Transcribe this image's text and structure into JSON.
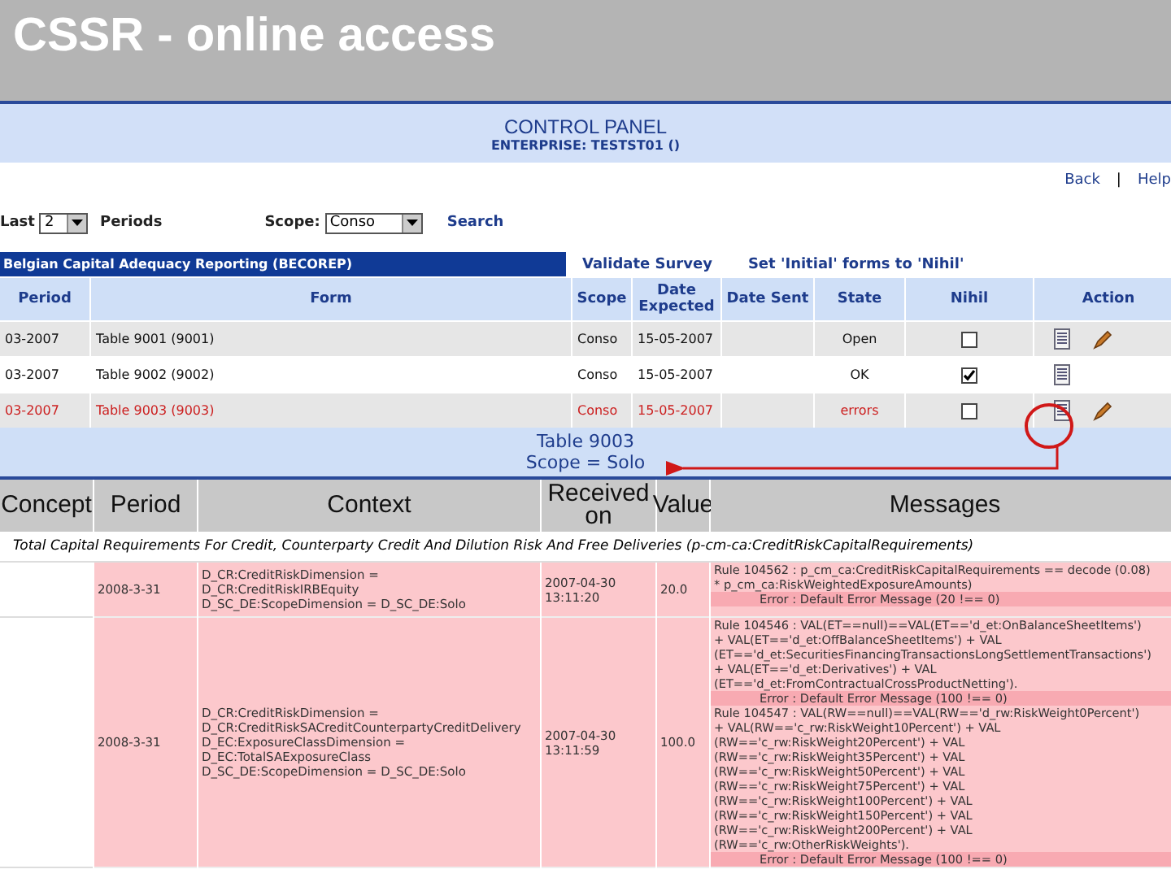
{
  "slide_title": "CSSR - online access",
  "control_panel": {
    "title": "CONTROL PANEL",
    "subtitle": "ENTERPRISE: TESTST01 ()"
  },
  "nav_links": [
    {
      "label": "Back"
    },
    {
      "label": "|",
      "kind": "separator"
    },
    {
      "label": "Help"
    }
  ],
  "filters": {
    "last_label": "Last",
    "periods_value": "2",
    "periods_label": "Periods",
    "scope_label": "Scope:",
    "scope_value": "Conso",
    "search_link": "Search"
  },
  "report": {
    "title": "Belgian Capital Adequacy Reporting  (BECOREP)",
    "links": [
      "Validate Survey",
      "Set 'Initial' forms to 'Nihil'"
    ]
  },
  "forms_table": {
    "columns": [
      "Period",
      "Form",
      "Scope",
      "Date Expected",
      "Date Sent",
      "State",
      "Nihil",
      "Action"
    ],
    "rows": [
      {
        "period": "03-2007",
        "form": "Table 9001  (9001)",
        "scope": "Conso",
        "date_expected": "15-05-2007",
        "state": "Open",
        "kind": "normal",
        "nihil": false,
        "edit_icon": true,
        "highlighted": false
      },
      {
        "period": "03-2007",
        "form": "Table 9002  (9002)",
        "scope": "Conso",
        "date_expected": "15-05-2007",
        "state": "OK",
        "kind": "normal",
        "nihil": true,
        "edit_icon": false,
        "highlighted": false
      },
      {
        "period": "03-2007",
        "form": "Table 9003  (9003)",
        "scope": "Conso",
        "date_expected": "15-05-2007",
        "state": "errors",
        "kind": "error",
        "nihil": false,
        "edit_icon": true,
        "highlighted": true
      }
    ]
  },
  "detail_panel": {
    "title": "Table 9003",
    "subtitle": "Scope = Solo"
  },
  "errors_table": {
    "columns": [
      "Concept",
      "Period",
      "Context",
      "Received on",
      "Value",
      "Messages"
    ],
    "concept_title": "Total Capital Requirements For Credit, Counterparty Credit And Dilution Risk And Free Deliveries  (p-cm-ca:CreditRiskCapitalRequirements)",
    "rows": [
      {
        "period": "2008-3-31",
        "context": [
          "D_CR:CreditRiskDimension = D_CR:CreditRiskIRBEquity",
          "D_SC_DE:ScopeDimension = D_SC_DE:Solo"
        ],
        "received_on": "2007-04-30 13:11:20",
        "value": "20.0",
        "messages": [
          {
            "kind": "rule",
            "lines": [
              "Rule 104562 : p_cm_ca:CreditRiskCapitalRequirements == decode (0.08)",
              "* p_cm_ca:RiskWeightedExposureAmounts)"
            ]
          },
          {
            "kind": "error",
            "lines": [
              "Error : Default Error Message (20 !== 0)"
            ]
          }
        ]
      },
      {
        "period": "2008-3-31",
        "context": [
          "D_CR:CreditRiskDimension = D_CR:CreditRiskSACreditCounterpartyCreditDelivery",
          "D_EC:ExposureClassDimension = D_EC:TotalSAExposureClass",
          "D_SC_DE:ScopeDimension = D_SC_DE:Solo"
        ],
        "received_on": "2007-04-30 13:11:59",
        "value": "100.0",
        "messages": [
          {
            "kind": "rule",
            "lines": [
              "Rule 104546 : VAL(ET==null)==VAL(ET=='d_et:OnBalanceSheetItems')",
              "+ VAL(ET=='d_et:OffBalanceSheetItems') + VAL",
              "(ET=='d_et:SecuritiesFinancingTransactionsLongSettlementTransactions')",
              "+ VAL(ET=='d_et:Derivatives') + VAL",
              "(ET=='d_et:FromContractualCrossProductNetting')."
            ]
          },
          {
            "kind": "error",
            "lines": [
              "Error : Default Error Message (100 !== 0)"
            ]
          },
          {
            "kind": "rule",
            "lines": [
              "Rule 104547 : VAL(RW==null)==VAL(RW=='d_rw:RiskWeight0Percent')",
              "+ VAL(RW=='c_rw:RiskWeight10Percent') + VAL",
              "(RW=='c_rw:RiskWeight20Percent') + VAL",
              "(RW=='c_rw:RiskWeight35Percent') + VAL",
              "(RW=='c_rw:RiskWeight50Percent') + VAL",
              "(RW=='c_rw:RiskWeight75Percent') + VAL",
              "(RW=='c_rw:RiskWeight100Percent') + VAL",
              "(RW=='c_rw:RiskWeight150Percent') + VAL",
              "(RW=='c_rw:RiskWeight200Percent') + VAL",
              "(RW=='c_rw:OtherRiskWeights')."
            ]
          },
          {
            "kind": "error",
            "lines": [
              "Error : Default Error Message (100 !== 0)"
            ]
          }
        ]
      }
    ]
  }
}
